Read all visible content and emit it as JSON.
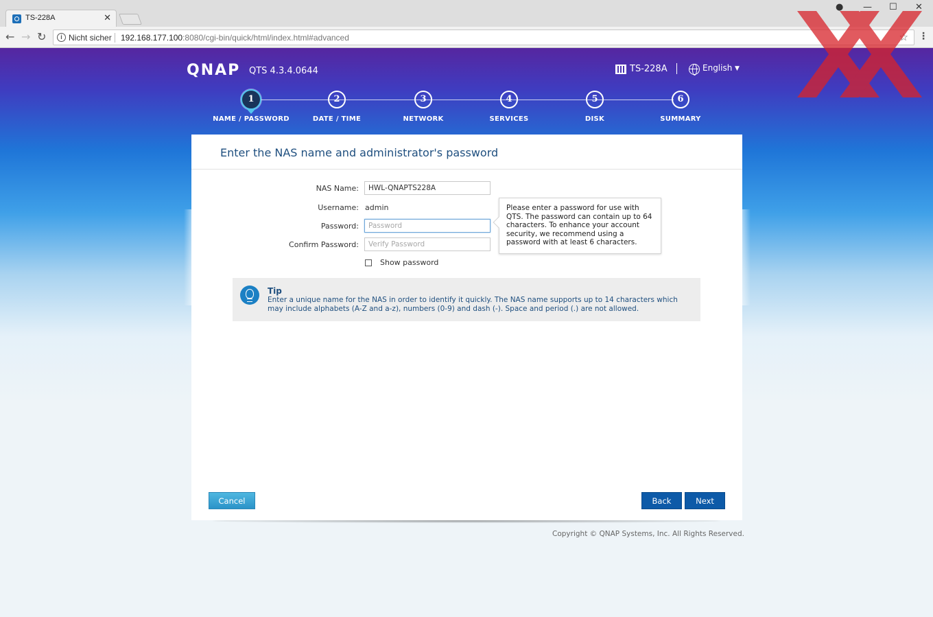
{
  "browser": {
    "tab_title": "TS-228A",
    "tab_close": "✕",
    "insecure_label": "Nicht sicher",
    "url_host": "192.168.177.100",
    "url_rest": ":8080/cgi-bin/quick/html/index.html#advanced"
  },
  "header": {
    "logo": "QNAP",
    "version": "QTS 4.3.4.0644",
    "model": "TS-228A",
    "language": "English"
  },
  "steps": [
    {
      "number": "1",
      "label": "NAME / PASSWORD",
      "active": true
    },
    {
      "number": "2",
      "label": "DATE / TIME",
      "active": false
    },
    {
      "number": "3",
      "label": "NETWORK",
      "active": false
    },
    {
      "number": "4",
      "label": "SERVICES",
      "active": false
    },
    {
      "number": "5",
      "label": "DISK",
      "active": false
    },
    {
      "number": "6",
      "label": "SUMMARY",
      "active": false
    }
  ],
  "form": {
    "title": "Enter the NAS name and administrator's password",
    "nas_name_label": "NAS Name:",
    "nas_name_value": "HWL-QNAPTS228A",
    "username_label": "Username:",
    "username_value": "admin",
    "password_label": "Password:",
    "password_placeholder": "Password",
    "confirm_label": "Confirm Password:",
    "confirm_placeholder": "Verify Password",
    "show_password_label": "Show password",
    "show_password_checked": false
  },
  "tooltip": {
    "text": "Please enter a password for use with QTS. The password can contain up to 64 characters. To enhance your account security, we recommend using a password with at least 6 characters."
  },
  "tip": {
    "title": "Tip",
    "text": "Enter a unique name for the NAS in order to identify it quickly. The NAS name supports up to 14 characters which may include alphabets (A-Z and a-z), numbers (0-9) and dash (-). Space and period (.) are not allowed."
  },
  "buttons": {
    "cancel": "Cancel",
    "back": "Back",
    "next": "Next"
  },
  "footer": {
    "copyright": "Copyright © QNAP Systems, Inc. All Rights Reserved."
  },
  "colors": {
    "accent": "#0d5aa8",
    "header_top": "#5626a0",
    "title_text": "#1f4f7f",
    "tip_icon": "#1b80c4"
  }
}
